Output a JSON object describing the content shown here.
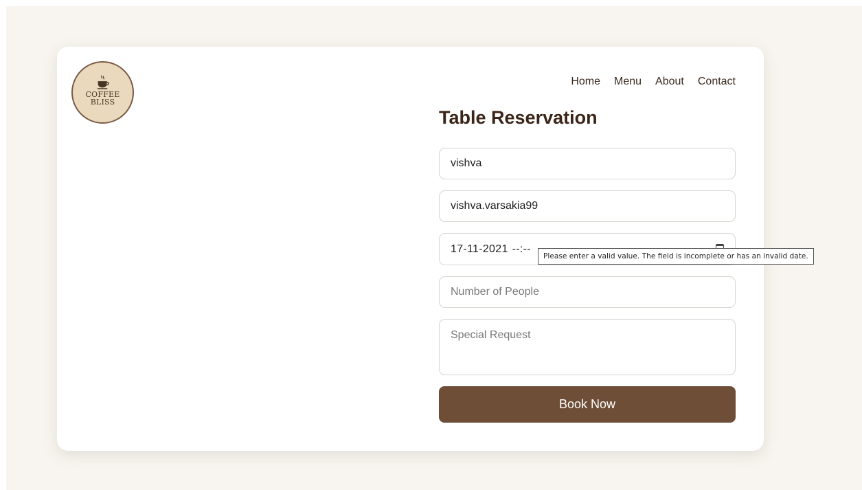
{
  "brand": {
    "line1": "COFFEE",
    "line2": "BLISS"
  },
  "nav": {
    "home": "Home",
    "menu": "Menu",
    "about": "About",
    "contact": "Contact"
  },
  "form": {
    "title": "Table Reservation",
    "name_value": "vishva",
    "email_value": "vishva.varsakia99",
    "date_value": "17-11-2021",
    "time_value": "--:--",
    "people_placeholder": "Number of People",
    "request_placeholder": "Special Request",
    "submit_label": "Book Now"
  },
  "validation": {
    "tooltip": "Please enter a valid value. The field is incomplete or has an invalid date."
  },
  "colors": {
    "primary": "#6f4e37",
    "background": "#f8f5f0",
    "text": "#3b2518"
  },
  "icons": {
    "logo": "coffee-cup-icon",
    "date_picker": "calendar-icon"
  }
}
